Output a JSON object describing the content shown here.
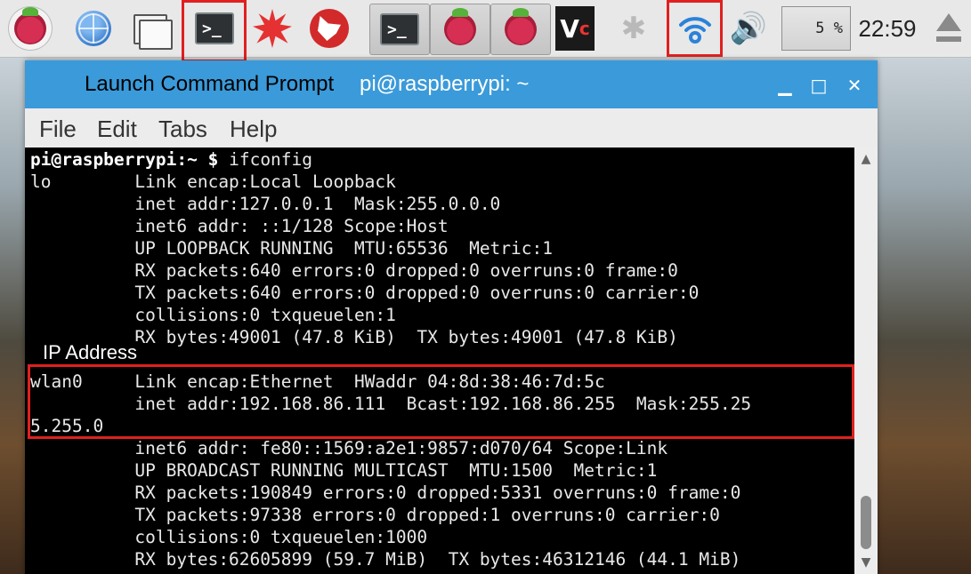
{
  "taskbar": {
    "clock": "22:59",
    "cpu_usage": "5 %",
    "icons": [
      "raspberry-menu-icon",
      "web-browser-icon",
      "file-manager-icon",
      "terminal-icon",
      "wolfram-icon",
      "mathematica-icon",
      "terminal-task-icon",
      "raspberry-task-icon",
      "raspberry-task-icon",
      "vnc-icon",
      "bluetooth-icon",
      "wifi-icon",
      "volume-icon",
      "eject-icon"
    ],
    "terminal_glyph": ">_",
    "vnc_glyph": "V",
    "vnc_glyph_c": "c"
  },
  "window": {
    "title_annotation": "Launch Command Prompt",
    "title": "pi@raspberrypi: ~",
    "menu": [
      "File",
      "Edit",
      "Tabs",
      "Help"
    ]
  },
  "annotations": {
    "ip_address_label": "IP Address",
    "accent_color": "#e02020"
  },
  "terminal": {
    "prompt_user": "pi@raspberrypi:~",
    "prompt_dollar": "$",
    "command": "ifconfig",
    "lines": [
      "lo        Link encap:Local Loopback",
      "          inet addr:127.0.0.1  Mask:255.0.0.0",
      "          inet6 addr: ::1/128 Scope:Host",
      "          UP LOOPBACK RUNNING  MTU:65536  Metric:1",
      "          RX packets:640 errors:0 dropped:0 overruns:0 frame:0",
      "          TX packets:640 errors:0 dropped:0 overruns:0 carrier:0",
      "          collisions:0 txqueuelen:1",
      "          RX bytes:49001 (47.8 KiB)  TX bytes:49001 (47.8 KiB)",
      "",
      "wlan0     Link encap:Ethernet  HWaddr 04:8d:38:46:7d:5c",
      "          inet addr:192.168.86.111  Bcast:192.168.86.255  Mask:255.25",
      "5.255.0",
      "          inet6 addr: fe80::1569:a2e1:9857:d070/64 Scope:Link",
      "          UP BROADCAST RUNNING MULTICAST  MTU:1500  Metric:1",
      "          RX packets:190849 errors:0 dropped:5331 overruns:0 frame:0",
      "          TX packets:97338 errors:0 dropped:1 overruns:0 carrier:0",
      "          collisions:0 txqueuelen:1000",
      "          RX bytes:62605899 (59.7 MiB)  TX bytes:46312146 (44.1 MiB)"
    ]
  }
}
